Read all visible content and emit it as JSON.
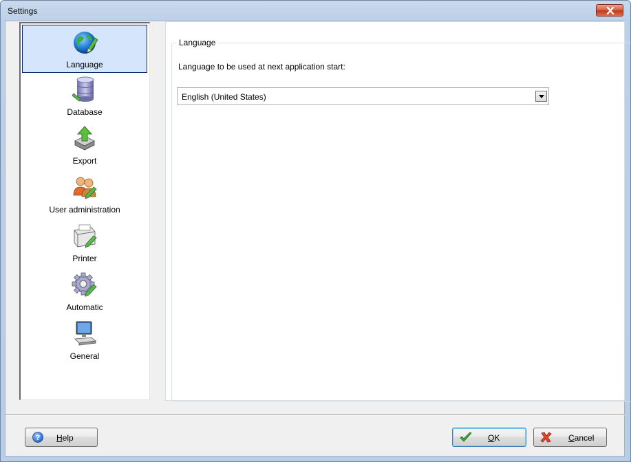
{
  "window": {
    "title": "Settings"
  },
  "nav": {
    "items": [
      {
        "label": "Language",
        "icon": "globe-pencil-icon",
        "selected": true
      },
      {
        "label": "Database",
        "icon": "database-pencil-icon",
        "selected": false
      },
      {
        "label": "Export",
        "icon": "export-arrow-icon",
        "selected": false
      },
      {
        "label": "User administration",
        "icon": "users-pencil-icon",
        "selected": false
      },
      {
        "label": "Printer",
        "icon": "printer-pencil-icon",
        "selected": false
      },
      {
        "label": "Automatic",
        "icon": "gear-pencil-icon",
        "selected": false
      },
      {
        "label": "General",
        "icon": "computer-icon",
        "selected": false
      }
    ]
  },
  "language_group": {
    "legend": "Language",
    "prompt": "Language to be used at next application start:",
    "selected_language": "English (United States)"
  },
  "buttons": {
    "help": {
      "mnemonic": "H",
      "rest": "elp"
    },
    "ok": {
      "mnemonic": "O",
      "rest": "K"
    },
    "cancel": {
      "mnemonic": "C",
      "rest": "ancel"
    }
  },
  "colors": {
    "selection_background": "#d5e5fb",
    "selection_border": "#0a246a",
    "close_button": "#c4381c"
  }
}
